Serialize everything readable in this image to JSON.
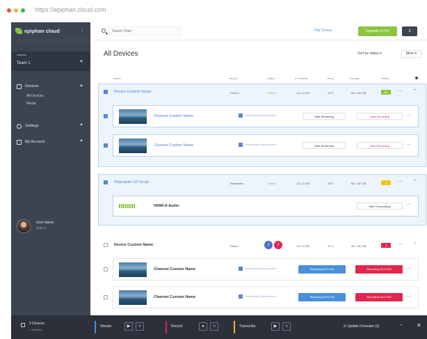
{
  "browser": {
    "url": "https://epiphan.cloud.com",
    "dot_colors": [
      "#e8524a",
      "#f2b533",
      "#2fb65a"
    ]
  },
  "sidebar": {
    "logo_text": "epiphan cloud",
    "team_label": "Team 1",
    "nav": [
      {
        "label": "Devices",
        "icon": "devices-icon"
      },
      {
        "label": "Settings",
        "icon": "gear-icon"
      },
      {
        "label": "My Account",
        "icon": "account-icon"
      }
    ],
    "subnav": [
      "All Devices",
      "Media"
    ],
    "user": {
      "name": "User Name",
      "team": "Team 1"
    }
  },
  "topbar": {
    "search_placeholder": "Search Filter",
    "pair_label": "Pair Device",
    "upgrade_label": "Upgrade to Pro",
    "notif_label": "3"
  },
  "main": {
    "title": "All Devices",
    "sort_label": "Sort by status",
    "more_label": "More",
    "columns": [
      "Name",
      "Model",
      "Status",
      "IP Address",
      "Temp",
      "Storage",
      "Health"
    ]
  },
  "groups": [
    {
      "name": "Device Custom Name",
      "model": "Pearl-2",
      "status": "Online",
      "ip": "10.1.2.200",
      "temp": "41°C",
      "storage": "80 / 160 GB",
      "health": "OK",
      "channels": [
        {
          "name": "Channel Custom Name",
          "layout": "Streaming Environment",
          "stream": "Start Streaming",
          "record": "Start Recording"
        },
        {
          "name": "Channel Custom Name",
          "layout": "Streaming Environment",
          "stream": "Start Streaming",
          "record": "Start Recording"
        }
      ]
    },
    {
      "name": "Webcaster X2 Script",
      "model": "Webcaster",
      "status": "Online",
      "ip": "10.1.2.226",
      "temp": "42°C",
      "storage": "80 / 160 GB",
      "health": "2",
      "channels": [
        {
          "name": "HDMI-A Audio",
          "stream": "Start Transcoding"
        }
      ]
    },
    {
      "name": "Device Custom Name",
      "model": "Pearl-2",
      "ip": "10.1.2.200",
      "temp": "41°C",
      "storage": "80 / 160 GB",
      "health": "3",
      "status_icons": [
        "2",
        "2"
      ],
      "channels": [
        {
          "name": "Channel Custom Name",
          "layout": "Streaming Environment",
          "stream": "Streaming 00:12:00",
          "record": "Recording 00:12:00"
        },
        {
          "name": "Channel Custom Name",
          "layout": "Streaming Environment",
          "stream": "Streaming 00:12:00",
          "record": "Recording 00:12:00"
        }
      ]
    }
  ],
  "bottombar": {
    "devices_label": "2 Devices",
    "selected_label": "2 selected",
    "stream_label": "Stream",
    "record_label": "Record",
    "transcribe_label": "Transcribe",
    "update_label": "Update Firmware (2)",
    "stream_color": "#4a90d9",
    "record_color": "#e2264f",
    "transcribe_color": "#f2b533"
  },
  "colors": {
    "accent_blue": "#4a86c8",
    "upgrade_green": "#8cc43f",
    "health_green": "#8cc43f",
    "health_yellow": "#f0c419",
    "health_red": "#e2264f",
    "status_blue": "#4a6fc4",
    "status_red": "#e2264f"
  }
}
